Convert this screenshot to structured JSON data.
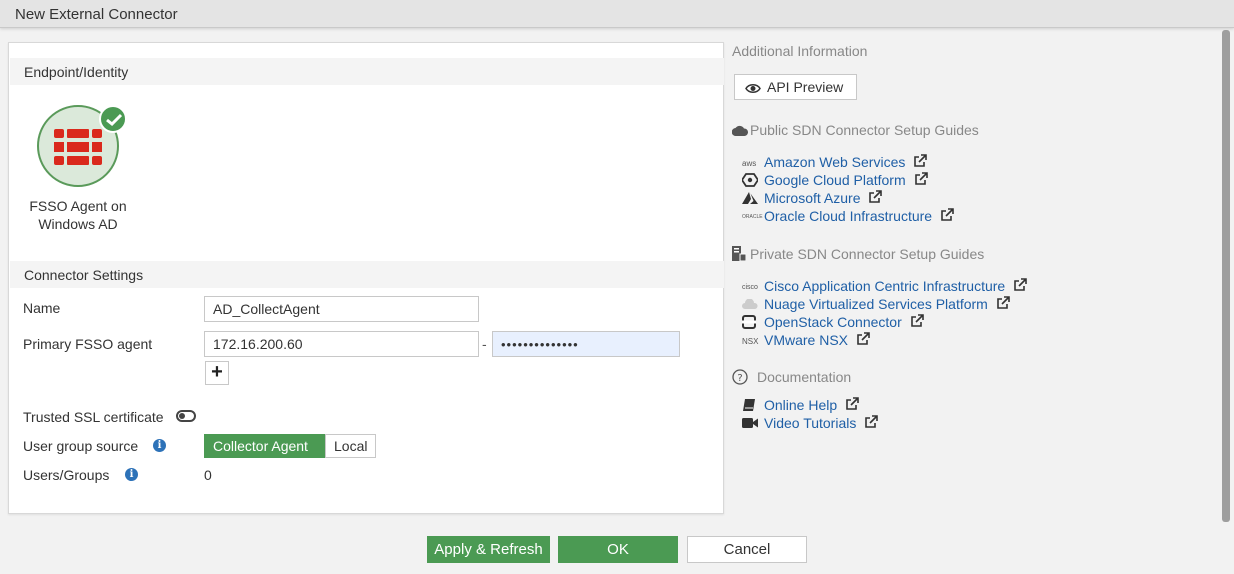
{
  "window": {
    "title": "New External Connector"
  },
  "endpoint": {
    "section_title": "Endpoint/Identity",
    "connector_label_line1": "FSSO Agent on",
    "connector_label_line2": "Windows AD",
    "selected": true
  },
  "settings": {
    "section_title": "Connector Settings",
    "name_label": "Name",
    "name_value": "AD_CollectAgent",
    "primary_label": "Primary FSSO agent",
    "primary_ip": "172.16.200.60",
    "primary_password": "••••••••••••••",
    "dash": "-",
    "trusted_ssl_label": "Trusted SSL certificate",
    "trusted_ssl_enabled": false,
    "group_source_label": "User group source",
    "group_source_options": [
      "Collector Agent",
      "Local"
    ],
    "group_source_selected": "Collector Agent",
    "users_groups_label": "Users/Groups",
    "users_groups_value": "0"
  },
  "side": {
    "additional_info_title": "Additional Information",
    "api_preview_label": "API Preview",
    "public_title": "Public SDN Connector Setup Guides",
    "public_links": [
      {
        "icon": "aws-icon",
        "icon_text": "aws",
        "label": "Amazon Web Services"
      },
      {
        "icon": "google-cloud-icon",
        "icon_text": "",
        "label": "Google Cloud Platform"
      },
      {
        "icon": "azure-icon",
        "icon_text": "",
        "label": "Microsoft Azure"
      },
      {
        "icon": "oracle-icon",
        "icon_text": "ORACLE",
        "label": "Oracle Cloud Infrastructure"
      }
    ],
    "private_title": "Private SDN Connector Setup Guides",
    "private_links": [
      {
        "icon": "cisco-icon",
        "icon_text": "cisco",
        "label": "Cisco Application Centric Infrastructure"
      },
      {
        "icon": "nuage-icon",
        "icon_text": "",
        "label": "Nuage Virtualized Services Platform"
      },
      {
        "icon": "openstack-icon",
        "icon_text": "",
        "label": "OpenStack Connector"
      },
      {
        "icon": "nsx-icon",
        "icon_text": "NSX",
        "label": "VMware NSX"
      }
    ],
    "docs_title": "Documentation",
    "doc_links": [
      {
        "icon": "book-icon",
        "label": "Online Help"
      },
      {
        "icon": "video-icon",
        "label": "Video Tutorials"
      }
    ]
  },
  "footer": {
    "apply_refresh_label": "Apply & Refresh",
    "ok_label": "OK",
    "cancel_label": "Cancel"
  },
  "colors": {
    "accent_green": "#4b9a53",
    "link_blue": "#1f5fa6",
    "fortinet_red": "#da291c"
  }
}
